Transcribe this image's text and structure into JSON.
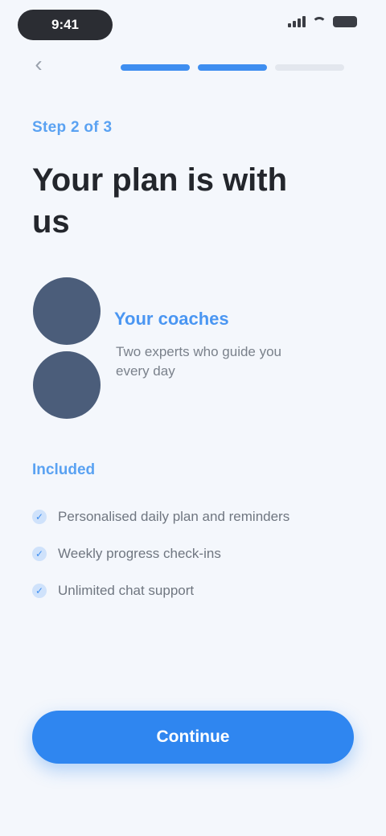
{
  "status_bar": {
    "time": "9:41",
    "icons": [
      "signal-icon",
      "wifi-icon",
      "battery-icon"
    ]
  },
  "nav": {
    "back_icon": "chevron-left-icon",
    "progress": {
      "total_steps": 3,
      "current_step": 2
    }
  },
  "content": {
    "step_label": "Step 2 of 3",
    "headline": "Your plan is with us",
    "coach": {
      "name": "Your coaches",
      "description": "Two experts who guide you every day"
    },
    "section_title": "Included",
    "checklist": [
      {
        "text": "Personalised daily plan and reminders"
      },
      {
        "text": "Weekly progress check-ins"
      },
      {
        "text": "Unlimited chat support"
      }
    ]
  },
  "footer": {
    "continue_label": "Continue"
  },
  "colors": {
    "accent": "#2f86f0",
    "background": "#f4f7fc",
    "avatar": "#4b5d7a"
  }
}
